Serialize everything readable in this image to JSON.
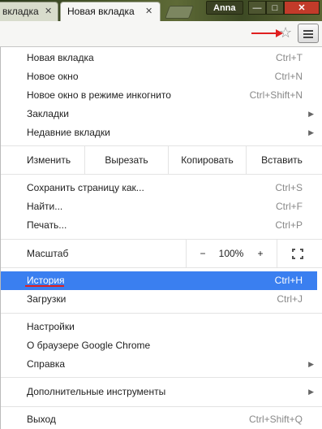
{
  "tabs": [
    {
      "label": "вкладка",
      "active": false
    },
    {
      "label": "Новая вкладка",
      "active": true
    }
  ],
  "window": {
    "profile": "Anna",
    "min": "—",
    "max": "□",
    "close": "✕"
  },
  "toolbar": {
    "star_icon": "star-icon",
    "menu_icon": "hamburger-icon"
  },
  "menu": {
    "group1": [
      {
        "label": "Новая вкладка",
        "shortcut": "Ctrl+T"
      },
      {
        "label": "Новое окно",
        "shortcut": "Ctrl+N"
      },
      {
        "label": "Новое окно в режиме инкогнито",
        "shortcut": "Ctrl+Shift+N"
      },
      {
        "label": "Закладки",
        "submenu": "▶"
      },
      {
        "label": "Недавние вкладки",
        "submenu": "▶"
      }
    ],
    "edit": {
      "label": "Изменить",
      "cut": "Вырезать",
      "copy": "Копировать",
      "paste": "Вставить"
    },
    "group2": [
      {
        "label": "Сохранить страницу как...",
        "shortcut": "Ctrl+S"
      },
      {
        "label": "Найти...",
        "shortcut": "Ctrl+F"
      },
      {
        "label": "Печать...",
        "shortcut": "Ctrl+P"
      }
    ],
    "zoom": {
      "label": "Масштаб",
      "minus": "−",
      "value": "100%",
      "plus": "+"
    },
    "group3": [
      {
        "label": "История",
        "shortcut": "Ctrl+H",
        "highlighted": true
      },
      {
        "label": "Загрузки",
        "shortcut": "Ctrl+J"
      }
    ],
    "group4": [
      {
        "label": "Настройки"
      },
      {
        "label": "О браузере Google Chrome"
      },
      {
        "label": "Справка",
        "submenu": "▶"
      }
    ],
    "group5": [
      {
        "label": "Дополнительные инструменты",
        "submenu": "▶"
      }
    ],
    "group6": [
      {
        "label": "Выход",
        "shortcut": "Ctrl+Shift+Q"
      }
    ]
  },
  "colors": {
    "highlight": "#3a7ff0",
    "annotation": "#e02020",
    "close_button": "#c23b2a"
  }
}
